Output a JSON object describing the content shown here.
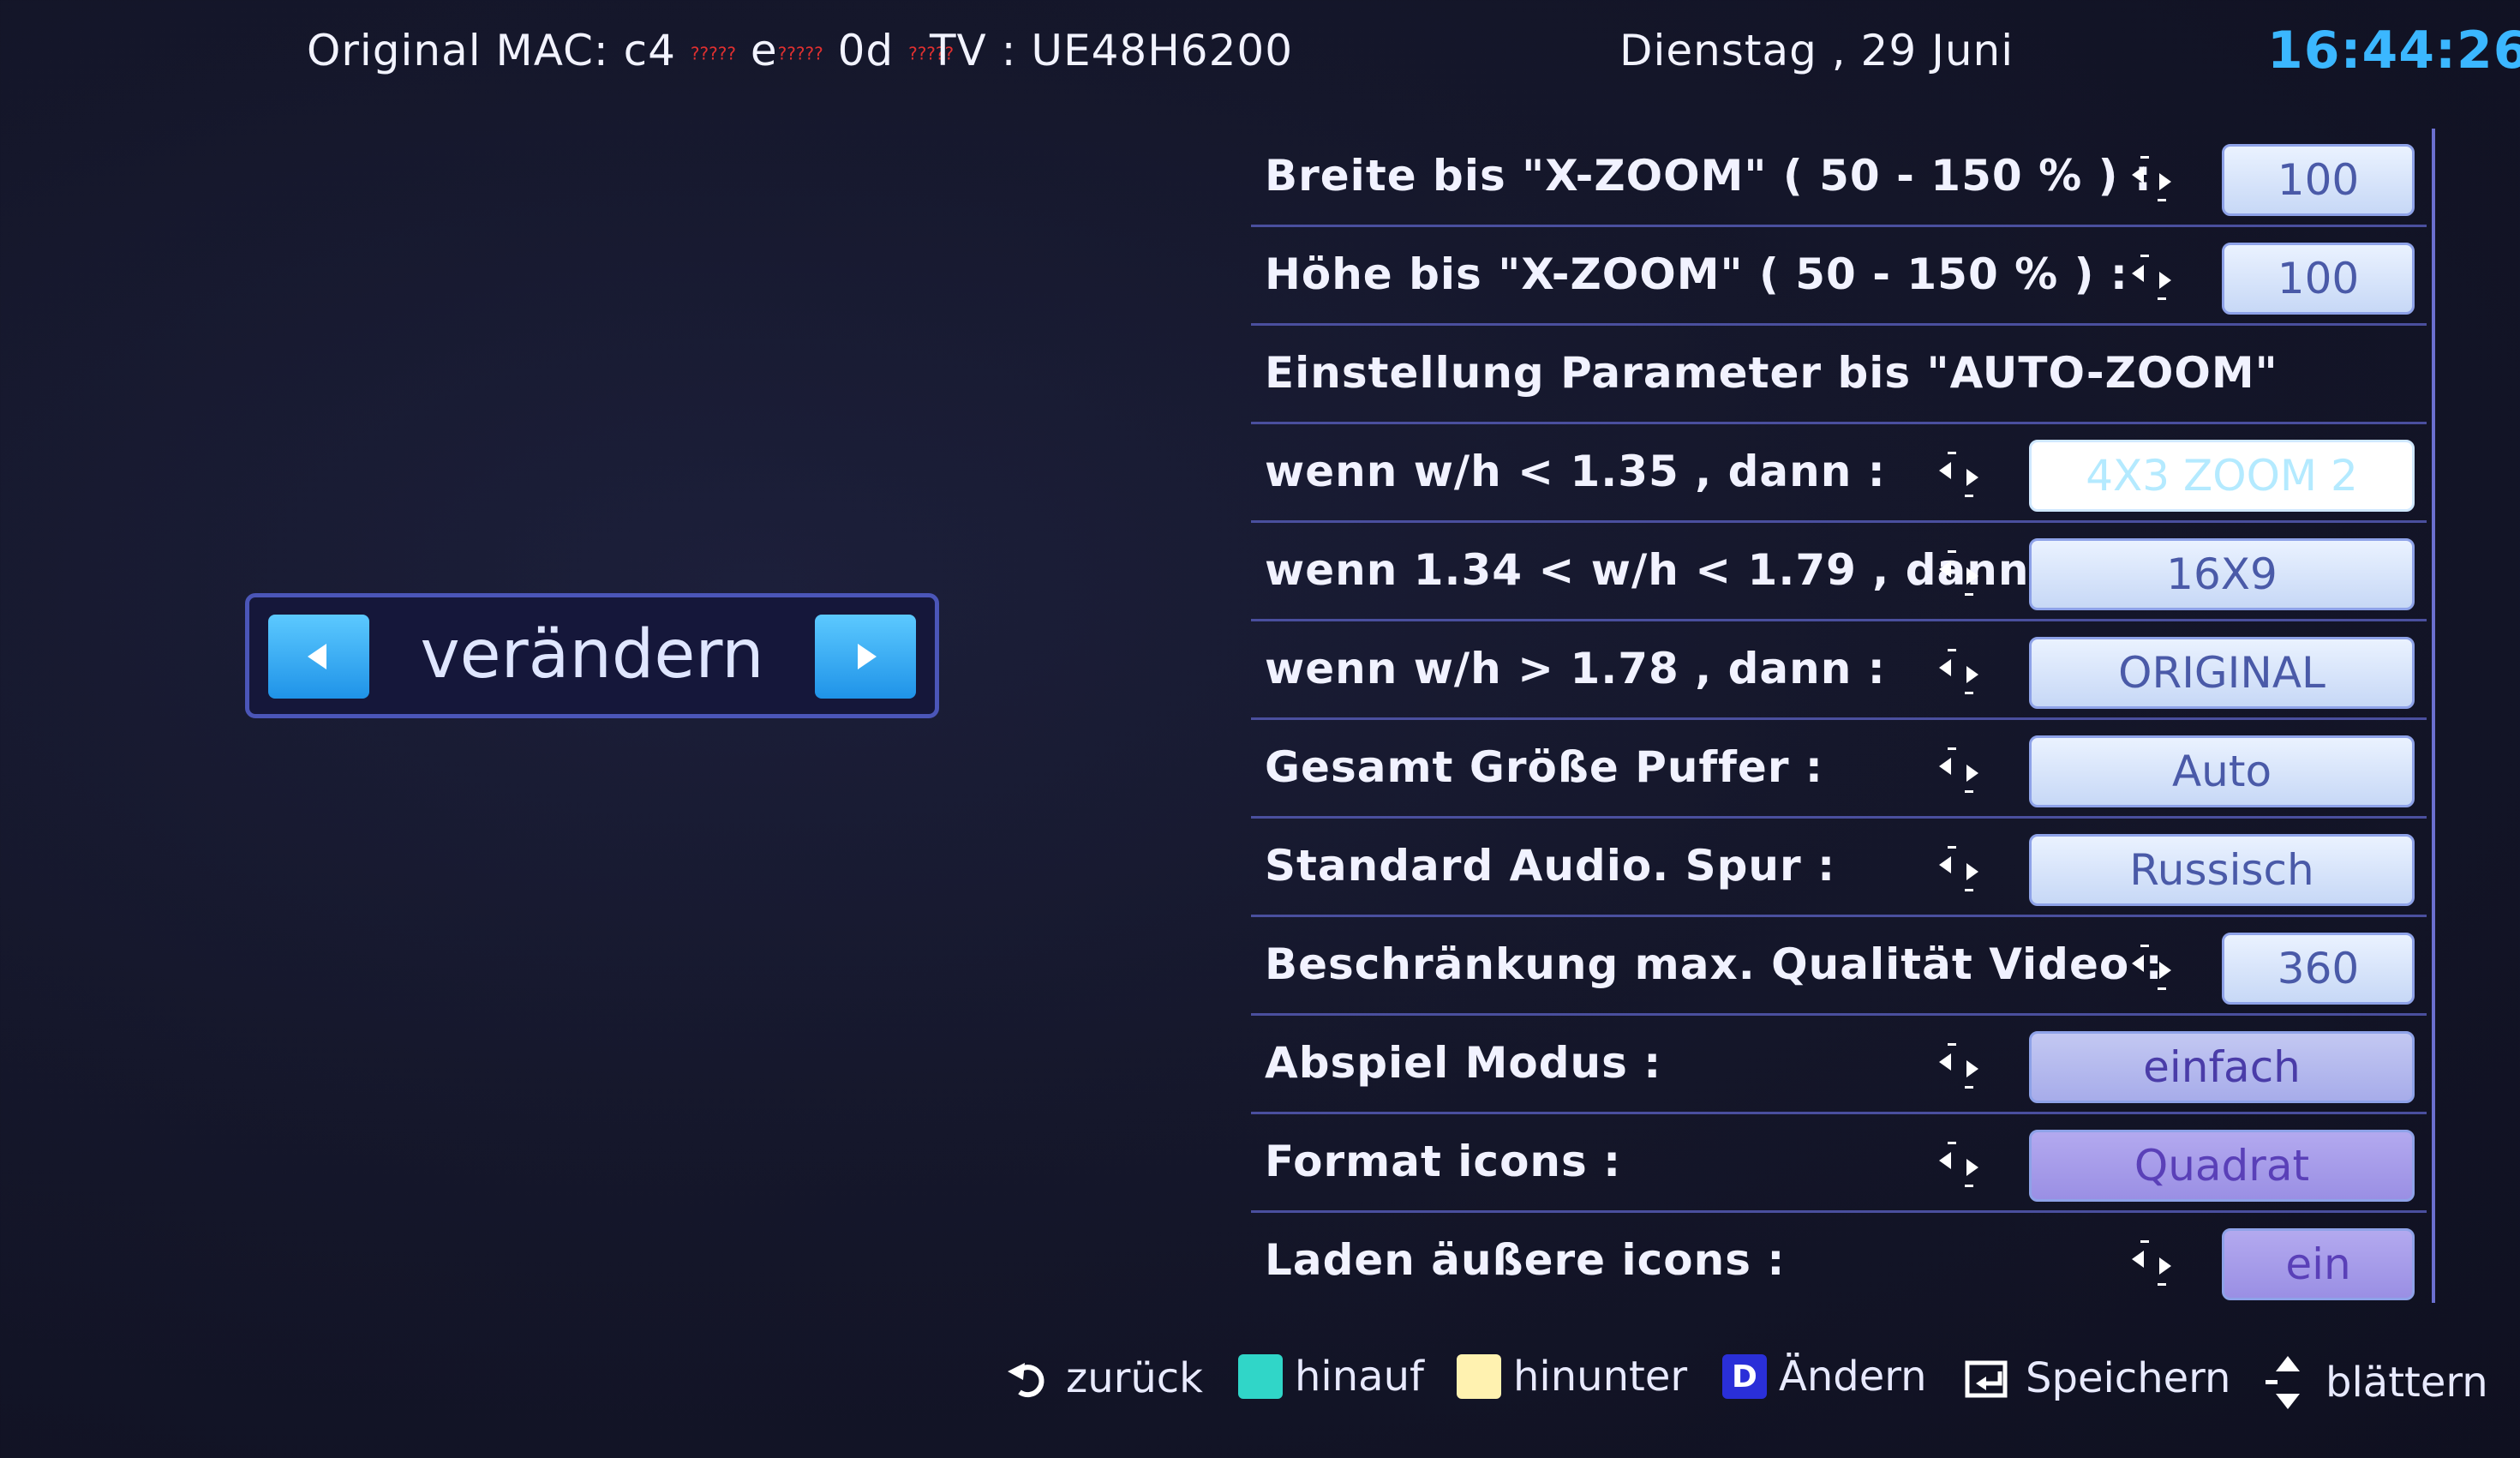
{
  "header": {
    "mac_label": "Original MAC: c4",
    "mac_mask": "?????",
    "mac_part2": "e",
    "mac_part3": "0d",
    "tv_label": "TV : UE48H6200",
    "date": "Dienstag , 29 Juni",
    "time": "16:44:26"
  },
  "left_panel": {
    "label": "verändern"
  },
  "menu": {
    "rows": [
      {
        "label": "Breite bis \"X-ZOOM\" ( 50 - 150 % ) :",
        "value": "100"
      },
      {
        "label": "Höhe bis \"X-ZOOM\" ( 50 - 150 % ) :",
        "value": "100"
      },
      {
        "label": "Einstellung Parameter bis \"AUTO-ZOOM\""
      },
      {
        "label": "wenn w/h < 1.35 , dann :",
        "value": "4X3 ZOOM 2"
      },
      {
        "label": "wenn 1.34 < w/h < 1.79 , dann :",
        "value": "16X9"
      },
      {
        "label": "wenn w/h > 1.78 , dann :",
        "value": "ORIGINAL"
      },
      {
        "label": "Gesamt Größe Puffer :",
        "value": "Auto"
      },
      {
        "label": "Standard Audio. Spur :",
        "value": "Russisch"
      },
      {
        "label": "Beschränkung max. Qualität Video :",
        "value": "360"
      },
      {
        "label": "Abspiel Modus :",
        "value": "einfach"
      },
      {
        "label": "Format icons :",
        "value": "Quadrat"
      },
      {
        "label": "Laden äußere icons :",
        "value": "ein"
      }
    ]
  },
  "footer": {
    "back": "zurück",
    "up": "hinauf",
    "down": "hinunter",
    "key_d": "D",
    "change": "Ändern",
    "save": "Speichern",
    "scroll": "blättern"
  },
  "colors": {
    "clock": "#3bb7ff",
    "accent_blue": "#1f93e8",
    "key_up": "#30d6c8",
    "key_down": "#fff2b0",
    "key_d": "#2a2fd8"
  }
}
